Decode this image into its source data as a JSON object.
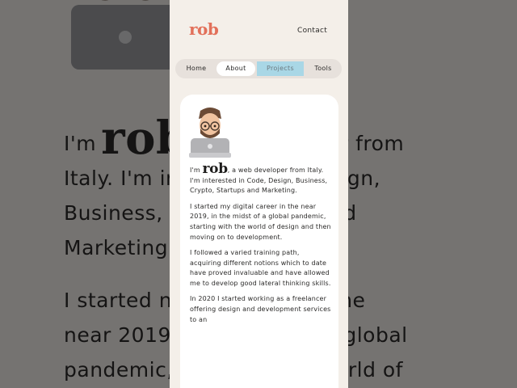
{
  "header": {
    "logo": "rob",
    "contact_label": "Contact"
  },
  "nav": {
    "items": [
      "Home",
      "About",
      "Projects",
      "Tools"
    ],
    "active": "About"
  },
  "intro": {
    "before": "I'm ",
    "name": "rob",
    "after": ", a web developer from Italy. I'm interested in Code, Design, Business, Crypto, Startups and Marketing."
  },
  "paragraphs": [
    "I started my digital career in the near 2019, in the midst of a global pandemic, starting with the world of design and then moving on to development.",
    "I followed a varied training path, acquiring different notions which to date have proved invaluable and have allowed me to develop good lateral thinking skills.",
    "In 2020 I started working as a freelancer offering design and development services to an"
  ],
  "background": {
    "line1_before": "I'm",
    "line1_name": "rob",
    "line1_after": "per from",
    "line2": "Italy. I'm in",
    "line2_end": ", Design,",
    "line3": "Business, C",
    "line3_end": "and",
    "line4": "Marketing",
    "para2_line1": "I started n",
    "para2_line1_end": "n the",
    "para2_line2": "near 2019,",
    "para2_line2_end": "global",
    "para2_line3": "pandemic,",
    "para2_line3_end": "e world of"
  },
  "colors": {
    "brand": "#e2705a",
    "page_bg": "#f4efe9",
    "nav_bg": "#e7e1dc",
    "projects_highlight": "#a9d7e6",
    "card_bg": "#ffffff"
  }
}
